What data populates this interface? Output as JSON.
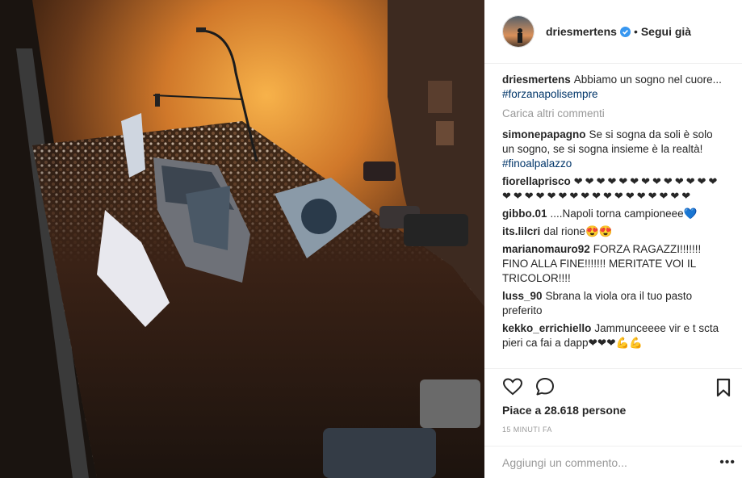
{
  "post": {
    "photo_icon": "crowd-street-photo"
  },
  "header": {
    "username": "driesmertens",
    "verified_icon": "verified-badge-icon",
    "separator": "•",
    "follow_label": "Segui già"
  },
  "caption": {
    "user": "driesmertens",
    "text": "Abbiamo un sogno nel cuore...",
    "hashtag": "#forzanapolisempre"
  },
  "load_more": "Carica altri commenti",
  "comments": [
    {
      "user": "simonepapagno",
      "text": "Se si sogna da soli è solo un sogno, se si sogna insieme è la realtà!",
      "hashtag": "#finoalpalazzo"
    },
    {
      "user": "fiorellaprisco",
      "text": "❤❤❤❤❤❤❤❤❤❤❤❤❤❤❤❤❤❤❤❤❤❤❤❤❤❤❤❤❤❤",
      "hashtag": ""
    },
    {
      "user": "gibbo.01",
      "text": "....Napoli torna campioneee💙",
      "hashtag": ""
    },
    {
      "user": "its.lilcri",
      "text": "dal rione😍😍",
      "hashtag": ""
    },
    {
      "user": "marianomauro92",
      "text": "FORZA RAGAZZI!!!!!!! FINO ALLA FINE!!!!!!! MERITATE VOI IL TRICOLOR!!!!",
      "hashtag": ""
    },
    {
      "user": "luss_90",
      "text": "Sbrana la viola ora il tuo pasto preferito",
      "hashtag": ""
    },
    {
      "user": "kekko_errichiello",
      "text": "Jammunceeee vir e t scta pieri ca fai a dapp❤❤❤💪💪",
      "hashtag": ""
    }
  ],
  "actions": {
    "like_icon": "heart-icon",
    "comment_icon": "comment-icon",
    "save_icon": "bookmark-icon"
  },
  "likes": "Piace a 28.618 persone",
  "timestamp": "15 MINUTI FA",
  "add_comment": {
    "placeholder": "Aggiungi un commento...",
    "more_label": "•••"
  },
  "colors": {
    "link": "#003569",
    "heart": "#ed4956",
    "muted": "#999999",
    "verified": "#3897f0"
  }
}
